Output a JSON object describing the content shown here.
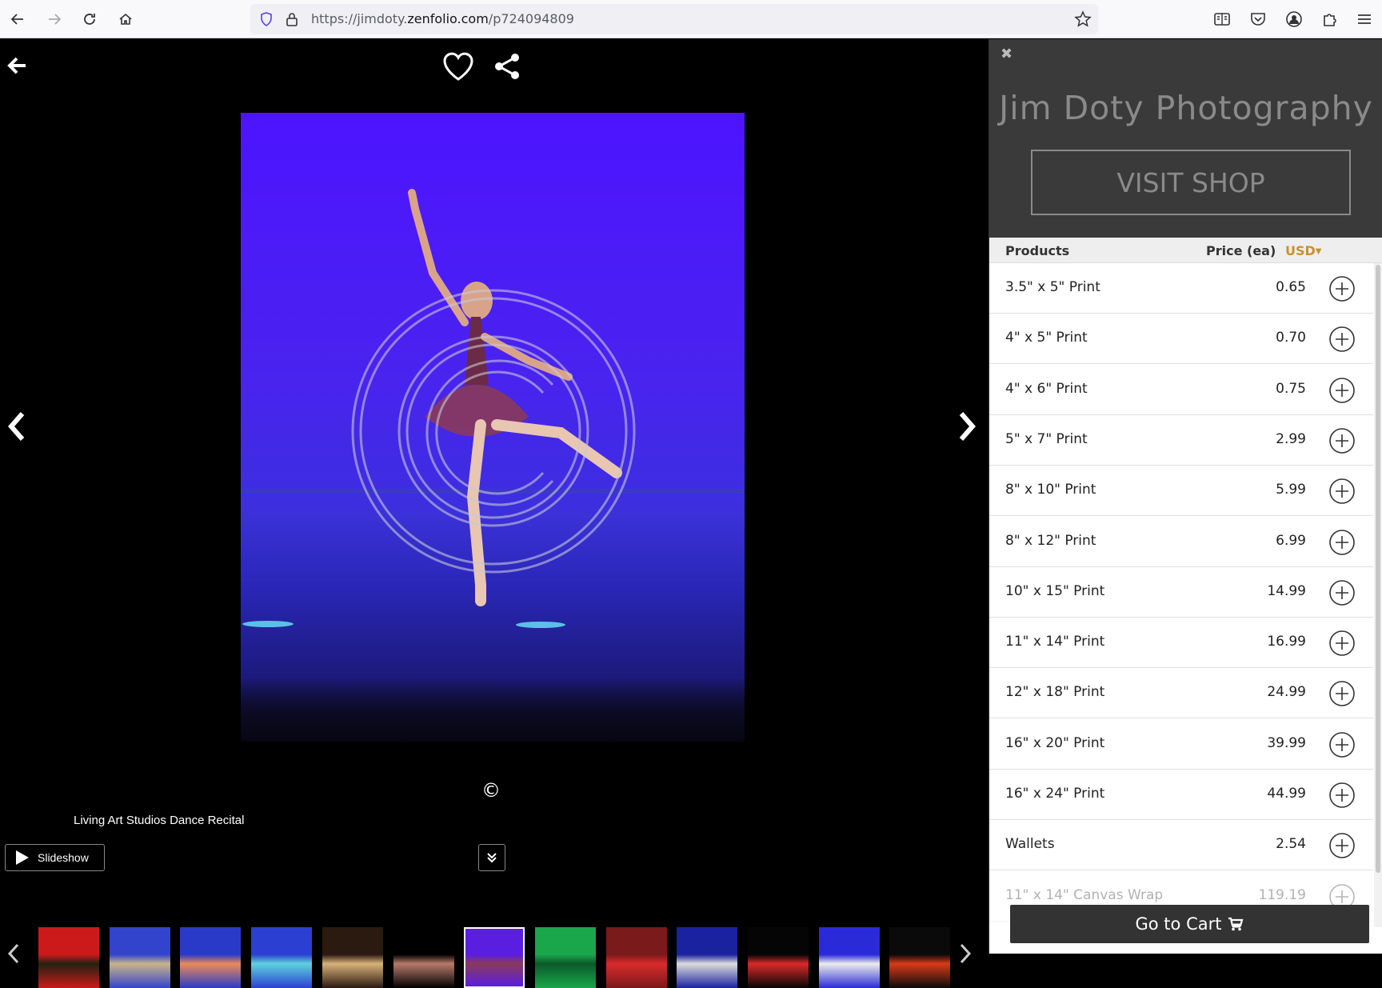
{
  "browser": {
    "url_prefix": "https://jimdoty.",
    "url_host": "zenfolio.com",
    "url_path": "/p724094809"
  },
  "viewer": {
    "gallery_title": "Living Art Studios Dance Recital",
    "slideshow_label": "Slideshow",
    "copyright_symbol": "©",
    "thumbnails": [
      {
        "colors": [
          "#cc1a1a",
          "#221"
        ]
      },
      {
        "colors": [
          "#3344cc",
          "#c9b48a"
        ]
      },
      {
        "colors": [
          "#2a3ac8",
          "#ea8a5a"
        ]
      },
      {
        "colors": [
          "#2b3fd2",
          "#5fd2dd"
        ]
      },
      {
        "colors": [
          "#2a1a10",
          "#d9b27a"
        ]
      },
      {
        "colors": [
          "#000000",
          "#b77a6a"
        ]
      },
      {
        "colors": [
          "#5a1ee0",
          "#8a3a5a"
        ]
      },
      {
        "colors": [
          "#1aa64a",
          "#0a5a2a"
        ]
      },
      {
        "colors": [
          "#7a1a1a",
          "#d92a2a"
        ]
      },
      {
        "colors": [
          "#1a22a0",
          "#dcdcdc"
        ]
      },
      {
        "colors": [
          "#050505",
          "#d92a2a"
        ]
      },
      {
        "colors": [
          "#2a2ad9",
          "#ececec"
        ]
      },
      {
        "colors": [
          "#0a0a0a",
          "#d93a1a"
        ]
      }
    ]
  },
  "panel": {
    "close_symbol": "✖",
    "studio_name": "Jim Doty Photography",
    "visit_shop_label": "VISIT SHOP",
    "products_header": "Products",
    "price_header": "Price (ea)",
    "currency": "USD",
    "products": [
      {
        "name": "3.5\" x 5\" Print",
        "price": "0.65"
      },
      {
        "name": "4\" x 5\" Print",
        "price": "0.70"
      },
      {
        "name": "4\" x 6\" Print",
        "price": "0.75"
      },
      {
        "name": "5\" x 7\" Print",
        "price": "2.99"
      },
      {
        "name": "8\" x 10\" Print",
        "price": "5.99"
      },
      {
        "name": "8\" x 12\" Print",
        "price": "6.99"
      },
      {
        "name": "10\" x 15\" Print",
        "price": "14.99"
      },
      {
        "name": "11\" x 14\" Print",
        "price": "16.99"
      },
      {
        "name": "12\" x 18\" Print",
        "price": "24.99"
      },
      {
        "name": "16\" x 20\" Print",
        "price": "39.99"
      },
      {
        "name": "16\" x 24\" Print",
        "price": "44.99"
      },
      {
        "name": "Wallets",
        "price": "2.54"
      },
      {
        "name": "11\" x 14\" Canvas Wrap",
        "price": "119.19"
      }
    ],
    "goto_cart_label": "Go to Cart"
  }
}
